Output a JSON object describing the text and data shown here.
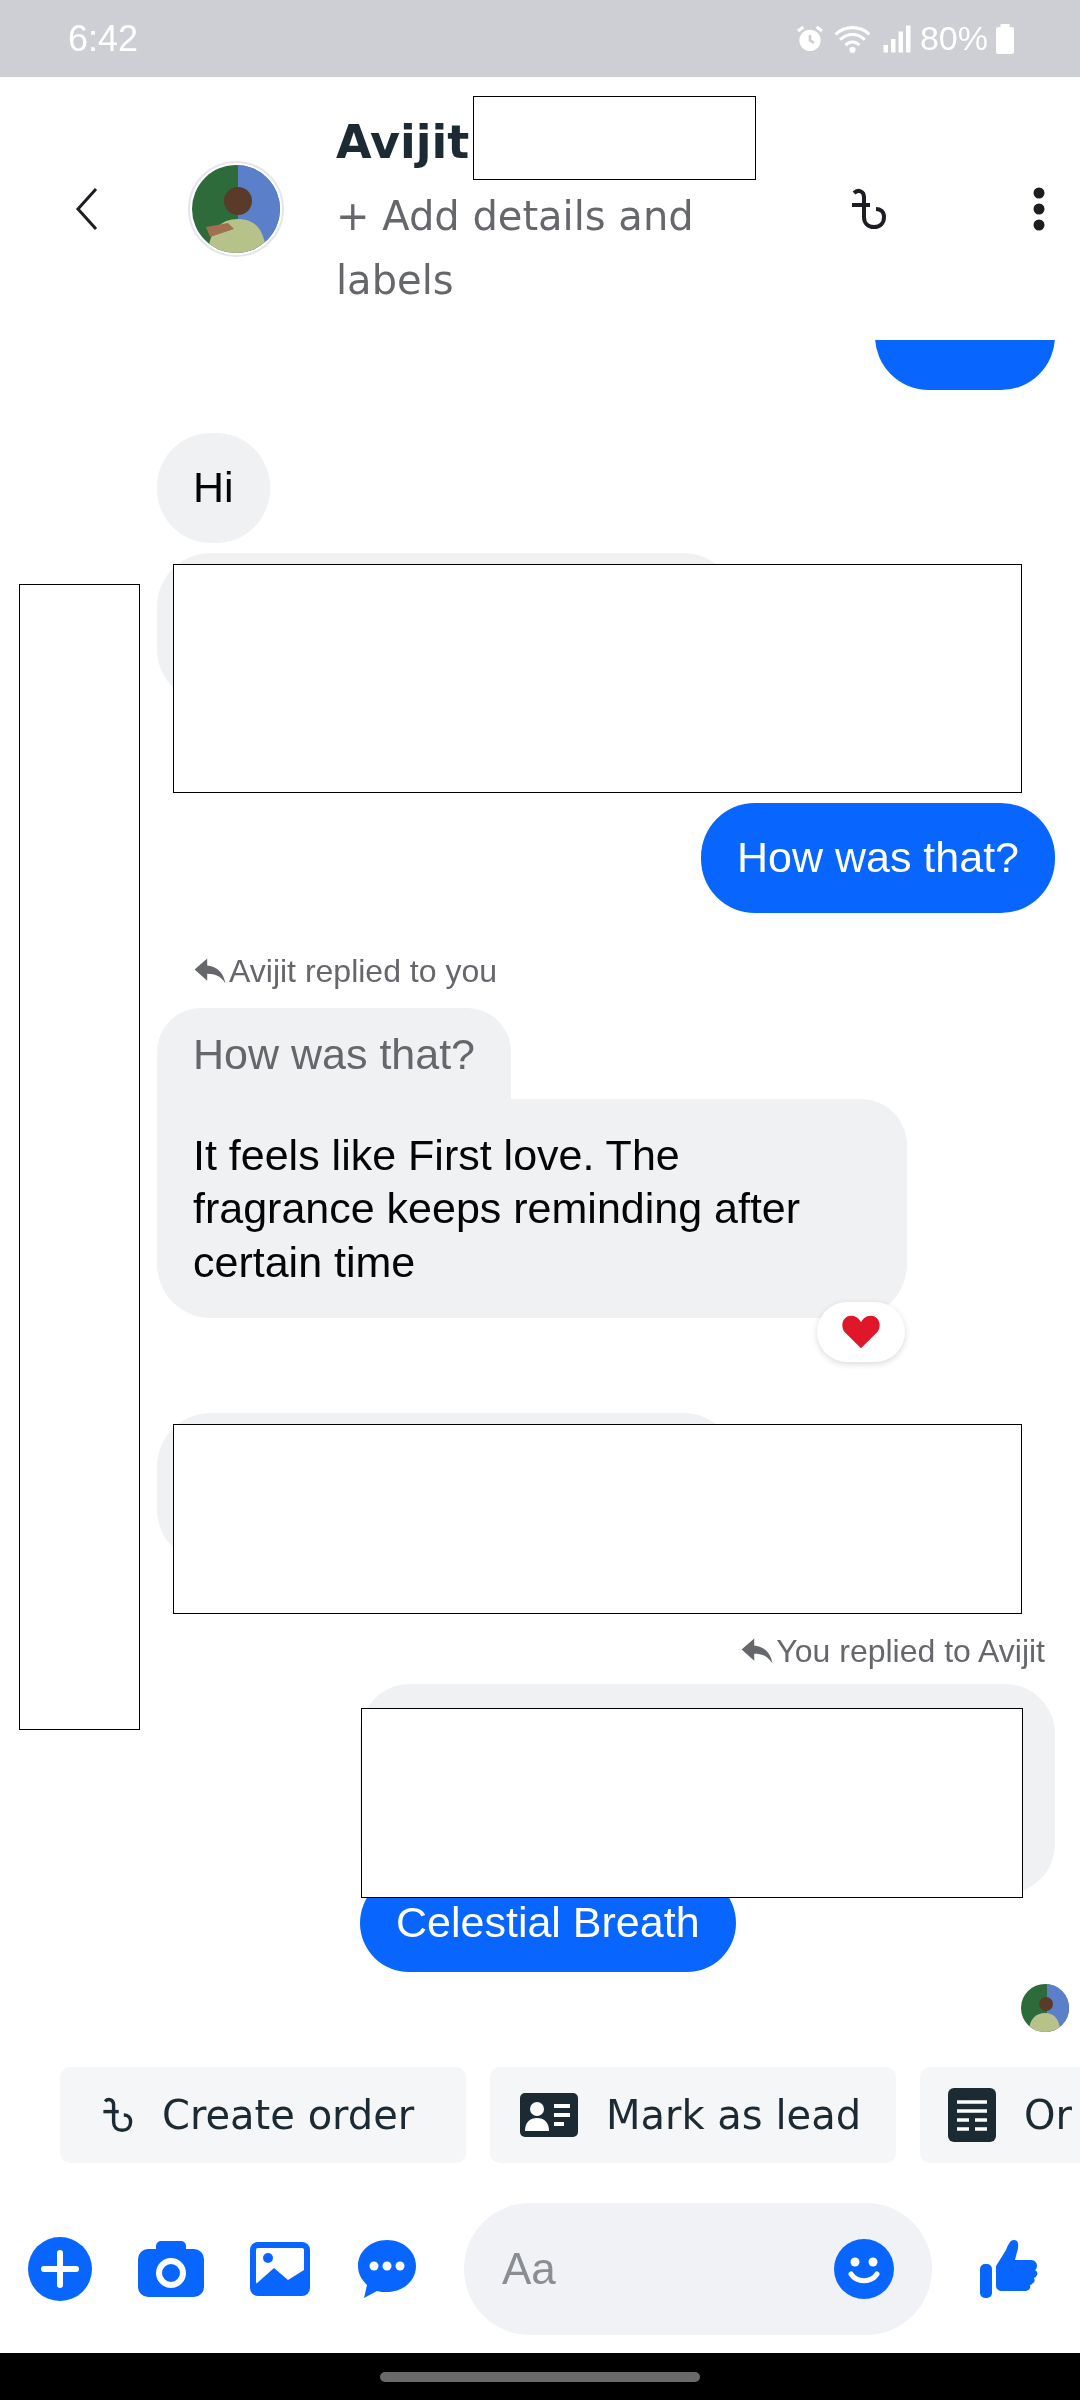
{
  "status_bar": {
    "time": "6:42",
    "battery": "80%"
  },
  "header": {
    "name": "Avijit",
    "subtitle": "+ Add details and labels"
  },
  "messages": [
    {
      "kind": "cut_outgoing"
    },
    {
      "kind": "incoming",
      "text": "Hi"
    },
    {
      "kind": "redacted_incoming"
    },
    {
      "kind": "outgoing",
      "text": "How was that?"
    },
    {
      "kind": "incoming_reply",
      "label": "Avijit replied to you",
      "quote": "How was that?",
      "text": "It feels like First love. The fragrance keeps reminding after certain time",
      "reacted": true
    },
    {
      "kind": "redacted_incoming"
    },
    {
      "kind": "outgoing_reply",
      "label": "You replied to Avijit",
      "text": "Celestial Breath"
    }
  ],
  "chips": [
    {
      "kind": "taka",
      "label": "Create order"
    },
    {
      "kind": "card",
      "label": "Mark as lead"
    },
    {
      "kind": "list",
      "label": "Or"
    }
  ],
  "composer": {
    "placeholder": "Aa"
  }
}
